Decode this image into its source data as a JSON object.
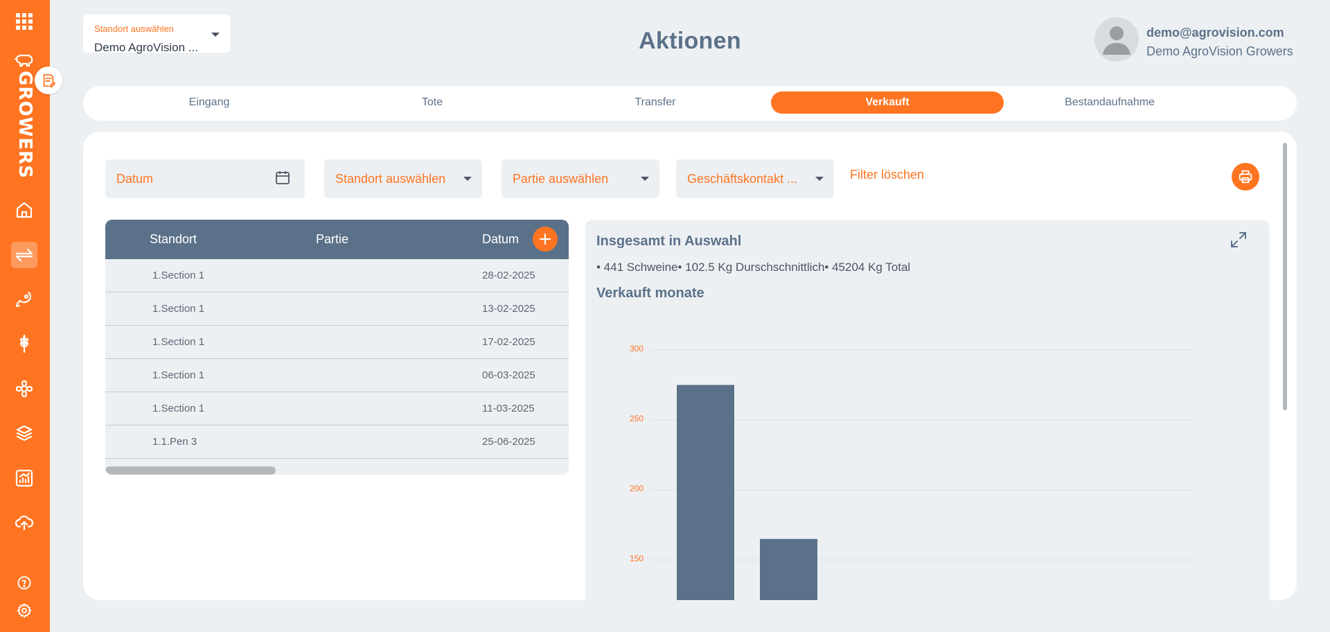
{
  "sidebar": {
    "brand": "GROWERS",
    "items": [
      {
        "icon": "grid-icon"
      },
      {
        "icon": "pig-icon"
      },
      {
        "icon": "home-icon"
      },
      {
        "icon": "transfer-icon",
        "active": true
      },
      {
        "icon": "meat-icon"
      },
      {
        "icon": "wheat-icon"
      },
      {
        "icon": "virus-icon"
      },
      {
        "icon": "layers-icon"
      },
      {
        "icon": "report-chart-icon"
      },
      {
        "icon": "upload-cloud-icon"
      },
      {
        "icon": "help-icon"
      },
      {
        "icon": "settings-icon"
      }
    ],
    "notes_icon": "edit-note-icon"
  },
  "header": {
    "location_select": {
      "label": "Standort auswählen",
      "value": "Demo AgroVision ..."
    },
    "title": "Aktionen",
    "user": {
      "email": "demo@agrovision.com",
      "org": "Demo AgroVision Growers"
    }
  },
  "tabs": [
    {
      "label": "Eingang",
      "active": false
    },
    {
      "label": "Tote",
      "active": false
    },
    {
      "label": "Transfer",
      "active": false
    },
    {
      "label": "Verkauft",
      "active": true
    },
    {
      "label": "Bestandaufnahme",
      "active": false
    }
  ],
  "filters": {
    "date_placeholder": "Datum",
    "location_placeholder": "Standort auswählen",
    "batch_placeholder": "Partie auswählen",
    "contact_placeholder": "Geschäftskontakt ...",
    "clear_label": "Filter löschen"
  },
  "table": {
    "columns": [
      "Standort",
      "Partie",
      "Datum"
    ],
    "rows": [
      {
        "standort": "1.Section 1",
        "partie": "",
        "datum": "28-02-2025"
      },
      {
        "standort": "1.Section 1",
        "partie": "",
        "datum": "13-02-2025"
      },
      {
        "standort": "1.Section 1",
        "partie": "",
        "datum": "17-02-2025"
      },
      {
        "standort": "1.Section 1",
        "partie": "",
        "datum": "06-03-2025"
      },
      {
        "standort": "1.Section 1",
        "partie": "",
        "datum": "11-03-2025"
      },
      {
        "standort": "1.1.Pen 3",
        "partie": "",
        "datum": "25-06-2025"
      }
    ]
  },
  "summary": {
    "title": "Insgesamt in Auswahl",
    "stats": "• 441 Schweine• 102.5 Kg Durschschnittlich• 45204 Kg Total",
    "chart_title": "Verkauft monate"
  },
  "colors": {
    "accent": "#ff7421",
    "header": "#5b7189",
    "bar": "#5b7189",
    "background": "#edf0f3"
  },
  "chart_data": {
    "type": "bar",
    "title": "Verkauft monate",
    "categories": [
      "",
      ""
    ],
    "values": [
      275,
      165
    ],
    "yticks": [
      150,
      200,
      250,
      300
    ],
    "ylim": [
      115,
      300
    ],
    "grid": true,
    "note": "Chart is cropped; only the upper portion of the first two bars is visible"
  }
}
